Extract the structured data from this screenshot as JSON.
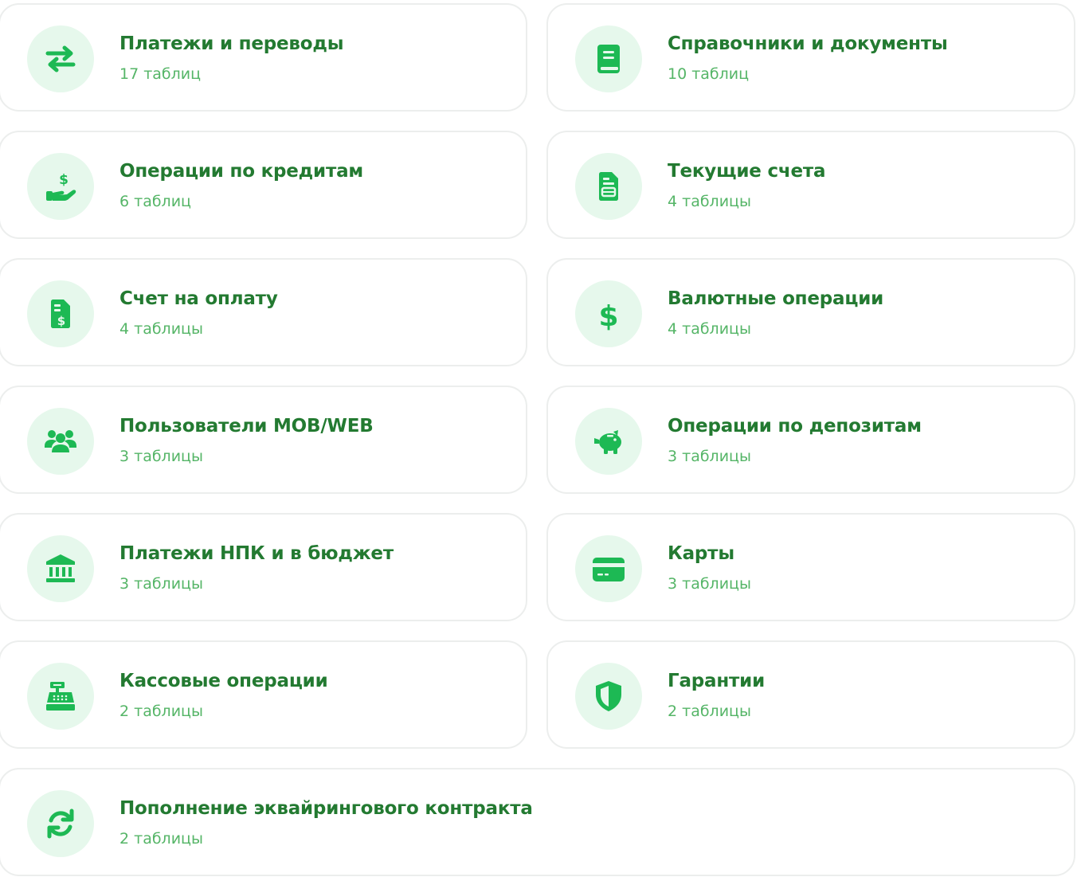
{
  "colors": {
    "accent": "#1db954",
    "title": "#237a31",
    "count": "#55b567",
    "icon_bg": "#e6f8ec",
    "card_border": "#eceeed"
  },
  "categories": [
    {
      "title": "Платежи и переводы",
      "count": "17 таблиц",
      "icon": "transfer-arrows-icon"
    },
    {
      "title": "Справочники и документы",
      "count": "10 таблиц",
      "icon": "book-icon"
    },
    {
      "title": "Операции по кредитам",
      "count": "6 таблиц",
      "icon": "hand-money-icon"
    },
    {
      "title": "Текущие счета",
      "count": "4 таблицы",
      "icon": "account-document-icon"
    },
    {
      "title": "Счет на оплату",
      "count": "4 таблицы",
      "icon": "invoice-dollar-icon"
    },
    {
      "title": "Валютные операции",
      "count": "4 таблицы",
      "icon": "dollar-sign-icon"
    },
    {
      "title": "Пользователи MOB/WEB",
      "count": "3 таблицы",
      "icon": "users-group-icon"
    },
    {
      "title": "Операции по депозитам",
      "count": "3 таблицы",
      "icon": "piggy-bank-icon"
    },
    {
      "title": "Платежи НПК и в бюджет",
      "count": "3 таблицы",
      "icon": "bank-building-icon"
    },
    {
      "title": "Карты",
      "count": "3 таблицы",
      "icon": "credit-card-icon"
    },
    {
      "title": "Кассовые операции",
      "count": "2 таблицы",
      "icon": "cash-register-icon"
    },
    {
      "title": "Гарантии",
      "count": "2 таблицы",
      "icon": "shield-icon"
    },
    {
      "title": "Пополнение эквайрингового контракта",
      "count": "2 таблицы",
      "icon": "refresh-icon"
    }
  ]
}
